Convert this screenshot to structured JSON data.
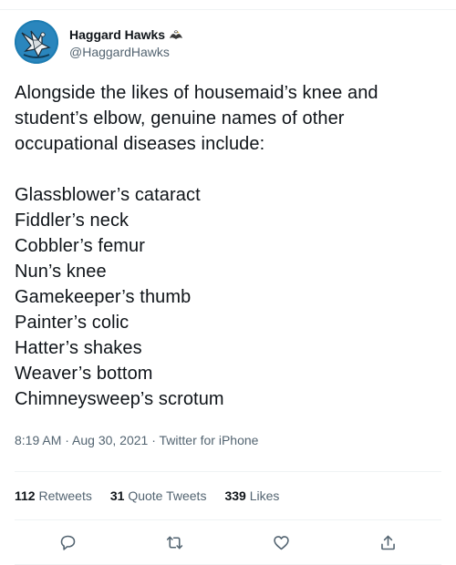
{
  "author": {
    "display_name": "Haggard Hawks",
    "handle": "@HaggardHawks",
    "avatar_icon": "bird-avatar-icon",
    "badge_icon": "eagle-emoji-icon"
  },
  "tweet": {
    "intro": "Alongside the likes of housemaid’s knee and student’s elbow, genuine names of other occupational diseases include:",
    "lines": [
      "Glassblower’s cataract",
      "Fiddler’s neck",
      "Cobbler’s femur",
      "Nun’s knee",
      "Gamekeeper’s thumb",
      "Painter’s colic",
      "Hatter’s shakes",
      "Weaver’s bottom",
      "Chimneysweep’s scrotum"
    ],
    "meta": "8:19 AM · Aug 30, 2021 · Twitter for iPhone"
  },
  "stats": {
    "retweets_count": "112",
    "retweets_label": "Retweets",
    "quotes_count": "31",
    "quotes_label": "Quote Tweets",
    "likes_count": "339",
    "likes_label": "Likes"
  },
  "actions": {
    "reply_icon": "reply-icon",
    "retweet_icon": "retweet-icon",
    "like_icon": "heart-icon",
    "share_icon": "share-icon"
  },
  "colors": {
    "text": "#0f1419",
    "secondary": "#536471",
    "divider": "#eff3f4",
    "avatar_bg": "#1d6f9e"
  }
}
